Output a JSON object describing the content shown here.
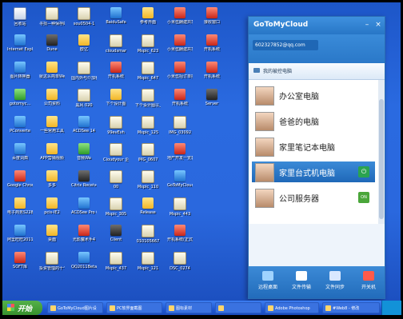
{
  "desktop": {
    "icons": [
      {
        "label": "回收站",
        "kind": "g-app"
      },
      {
        "label": "寻找—种保存的本电脑",
        "kind": "g-doc"
      },
      {
        "label": "sou0504-1",
        "kind": "g-doc"
      },
      {
        "label": "BaiduSafe",
        "kind": "g-exe"
      },
      {
        "label": "参考界面",
        "kind": "g-folder"
      },
      {
        "label": "小米伍酬建共享人机地",
        "kind": "g-red"
      },
      {
        "label": "接收窗口",
        "kind": "g-red"
      },
      {
        "label": "Internet Explorer",
        "kind": "g-exe"
      },
      {
        "label": "Dune",
        "kind": "g-dark"
      },
      {
        "label": "欧亿",
        "kind": "g-folder"
      },
      {
        "label": "cloudsmar",
        "kind": "g-doc"
      },
      {
        "label": "Mspic_623",
        "kind": "g-doc"
      },
      {
        "label": "小米伍酬建共享被管理员",
        "kind": "g-red"
      },
      {
        "label": "开机系统",
        "kind": "g-red"
      },
      {
        "label": "图片转换器",
        "kind": "g-exe"
      },
      {
        "label": "就这么简单WebPh发布",
        "kind": "g-folder"
      },
      {
        "label": "国内外与介加我版人标",
        "kind": "g-doc"
      },
      {
        "label": "开机系统",
        "kind": "g-red"
      },
      {
        "label": "Mspic_647",
        "kind": "g-doc"
      },
      {
        "label": "小米伍招订单搜索列表",
        "kind": "g-red"
      },
      {
        "label": "开机系统",
        "kind": "g-red"
      },
      {
        "label": "gotomyc...",
        "kind": "g-green"
      },
      {
        "label": "公司资料",
        "kind": "g-folder"
      },
      {
        "label": "黑风 020",
        "kind": "g-doc"
      },
      {
        "label": "下个设计图",
        "kind": "g-folder"
      },
      {
        "label": "下个设计图以上报价",
        "kind": "g-doc"
      },
      {
        "label": "开机系统",
        "kind": "g-red"
      },
      {
        "label": "Server",
        "kind": "g-dark"
      },
      {
        "label": "PConverte",
        "kind": "g-exe"
      },
      {
        "label": "一些常用工具",
        "kind": "g-folder"
      },
      {
        "label": "ACDSee 14",
        "kind": "g-exe"
      },
      {
        "label": "99evEvh",
        "kind": "g-doc"
      },
      {
        "label": "Mspic_125",
        "kind": "g-doc"
      },
      {
        "label": "IMG_03092",
        "kind": "g-doc"
      },
      {
        "label": "",
        "kind": "g-doc"
      },
      {
        "label": "百度词典",
        "kind": "g-exe"
      },
      {
        "label": "APP营销视频",
        "kind": "g-folder"
      },
      {
        "label": "音频Wa",
        "kind": "g-green"
      },
      {
        "label": "Cloudyour 企业说明资料",
        "kind": "g-doc"
      },
      {
        "label": "IMG_0607",
        "kind": "g-doc"
      },
      {
        "label": "地产开发一览表",
        "kind": "g-red"
      },
      {
        "label": "",
        "kind": "g-doc"
      },
      {
        "label": "Google Chrome",
        "kind": "g-red"
      },
      {
        "label": "多多",
        "kind": "g-folder"
      },
      {
        "label": "Citrix Receiver",
        "kind": "g-dark"
      },
      {
        "label": "00",
        "kind": "g-doc"
      },
      {
        "label": "Mspic_110",
        "kind": "g-doc"
      },
      {
        "label": "GoToMyCloud 主控端",
        "kind": "g-exe"
      },
      {
        "label": "",
        "kind": "g-doc"
      },
      {
        "label": "电子商务S228",
        "kind": "g-folder"
      },
      {
        "label": "pcis-IE2",
        "kind": "g-folder"
      },
      {
        "label": "ACDSee Pro 6",
        "kind": "g-exe"
      },
      {
        "label": "Mspic_305",
        "kind": "g-doc"
      },
      {
        "label": "Release",
        "kind": "g-folder"
      },
      {
        "label": "Mspic_443",
        "kind": "g-doc"
      },
      {
        "label": "",
        "kind": "g-doc"
      },
      {
        "label": "阿里旺旺2011",
        "kind": "g-exe"
      },
      {
        "label": "桌面",
        "kind": "g-folder"
      },
      {
        "label": "光影魔术手4",
        "kind": "g-red"
      },
      {
        "label": "Client",
        "kind": "g-dark"
      },
      {
        "label": "010105667",
        "kind": "g-doc"
      },
      {
        "label": "开机系统(正式)",
        "kind": "g-red"
      },
      {
        "label": "",
        "kind": "g-doc"
      },
      {
        "label": "SOFT库",
        "kind": "g-red"
      },
      {
        "label": "投资管理的十个问题案例",
        "kind": "g-doc"
      },
      {
        "label": "QQ2011Beta2",
        "kind": "g-exe"
      },
      {
        "label": "Mspic_437",
        "kind": "g-doc"
      },
      {
        "label": "Mspic_121",
        "kind": "g-doc"
      },
      {
        "label": "DSC_0274",
        "kind": "g-doc"
      },
      {
        "label": "",
        "kind": "g-doc"
      }
    ]
  },
  "panel": {
    "title": "GoToMyCloud",
    "minimize": "–",
    "close": "×",
    "email": "602327852@qq.com",
    "group_label": "我的被控电脑",
    "devices": [
      {
        "name": "办公室电脑",
        "status": "",
        "selected": false
      },
      {
        "name": "爸爸的电脑",
        "status": "",
        "selected": false
      },
      {
        "name": "家里笔记本电脑",
        "status": "",
        "selected": false
      },
      {
        "name": "家里台式机电脑",
        "status": "⏻",
        "selected": true
      },
      {
        "name": "公司服务器",
        "status": "ON",
        "selected": false
      }
    ],
    "footer": [
      {
        "label": "远程桌面",
        "icon": "monitor-icon",
        "color": "#9fd3ff"
      },
      {
        "label": "文件传输",
        "icon": "mail-icon",
        "color": "#ffffff"
      },
      {
        "label": "文件同步",
        "icon": "sync-icon",
        "color": "#d9e8ff"
      },
      {
        "label": "开关机",
        "icon": "power-icon",
        "color": "#ff5a4a"
      }
    ]
  },
  "taskbar": {
    "start_label": "开始",
    "tasks": [
      "GoToMyCloud图片设",
      "PC软界面截图",
      "图标素材",
      "",
      "Adobe Photoshop",
      "#Web8 - 修改"
    ]
  }
}
